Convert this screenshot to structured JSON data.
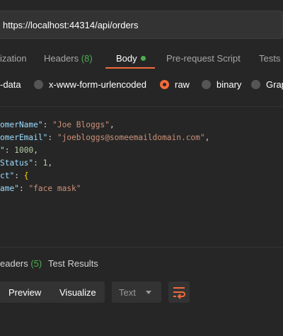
{
  "request": {
    "url": "https://localhost:44314/api/orders"
  },
  "tabs": [
    {
      "label": "ization"
    },
    {
      "label": "Headers",
      "count": "(8)"
    },
    {
      "label": "Body"
    },
    {
      "label": "Pre-request Script"
    },
    {
      "label": "Tests"
    }
  ],
  "body_types": [
    {
      "label": "-data",
      "checked": false
    },
    {
      "label": "x-www-form-urlencoded",
      "checked": false
    },
    {
      "label": "raw",
      "checked": true
    },
    {
      "label": "binary",
      "checked": false
    },
    {
      "label": "Grap",
      "checked": false
    }
  ],
  "code": {
    "line1_key": "omerName\"",
    "line1_val": "\"Joe Bloggs\"",
    "line2_key": "omerEmail\"",
    "line2_val": "\"joebloggs@someemaildomain.com\"",
    "line3_key": "\"",
    "line3_val": "1000",
    "line4_key": "Status\"",
    "line4_val": "1",
    "line5_key": "ct\"",
    "line5_val": "{",
    "line6_key": "ame\"",
    "line6_val": "\"face mask\""
  },
  "response": {
    "tabs": [
      {
        "label": "eaders",
        "count": "(5)"
      },
      {
        "label": "Test Results"
      }
    ],
    "preview_label": "Preview",
    "visualize_label": "Visualize",
    "format_selected": "Text"
  },
  "colors": {
    "accent": "#f26b3a",
    "success": "#4caf50"
  },
  "icons": {
    "status_dot": "green-dot-icon",
    "wrap": "wrap-lines-icon",
    "caret": "chevron-down-icon"
  }
}
